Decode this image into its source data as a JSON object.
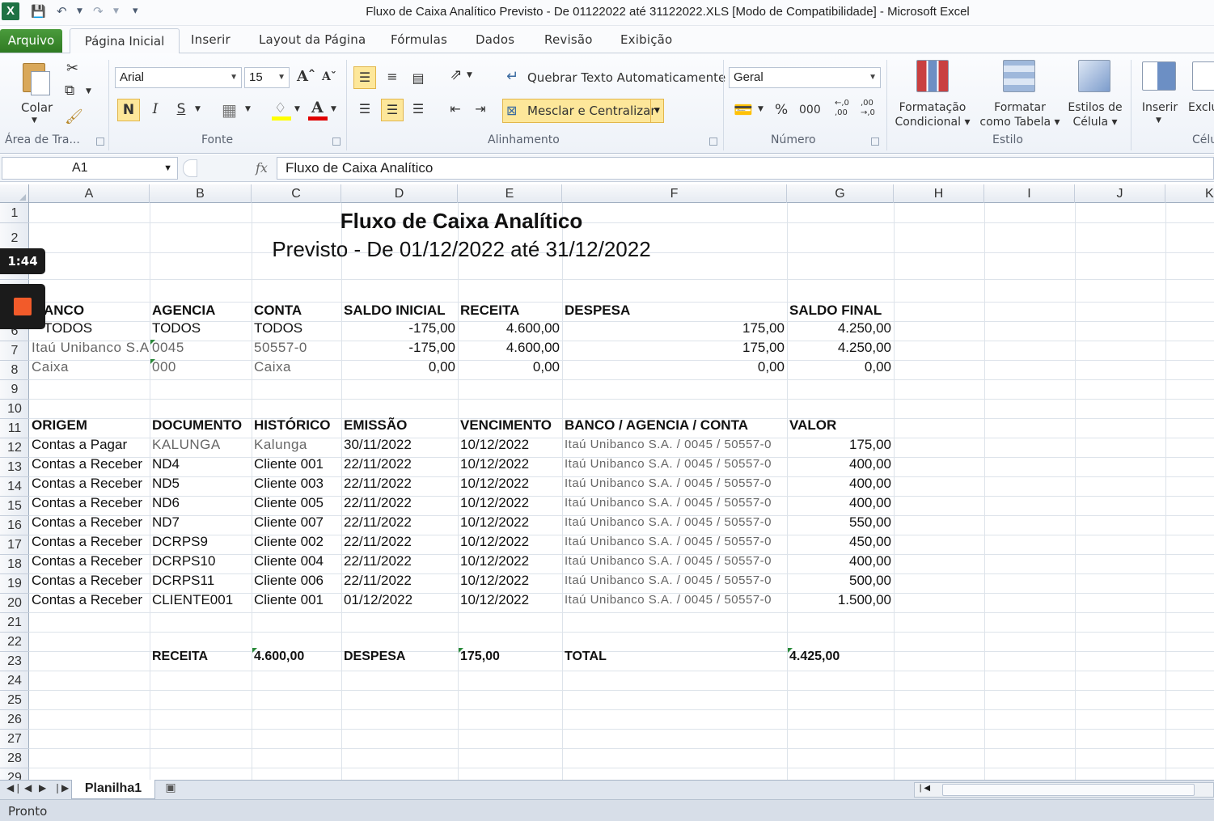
{
  "window": {
    "title": "Fluxo de Caixa Analítico Previsto - De 01122022 até 31122022.XLS  [Modo de Compatibilidade]  -  Microsoft Excel",
    "app_icon": "X"
  },
  "ribbon_tabs": [
    "Arquivo",
    "Página Inicial",
    "Inserir",
    "Layout da Página",
    "Fórmulas",
    "Dados",
    "Revisão",
    "Exibição"
  ],
  "ribbon": {
    "clipboard": {
      "paste_label": "Colar",
      "group_label": "Área de Tra..."
    },
    "font": {
      "font_name": "Arial",
      "font_size": "15",
      "bold": "N",
      "italic": "I",
      "underline": "S",
      "group_label": "Fonte"
    },
    "alignment": {
      "wrap_text": "Quebrar Texto Automaticamente",
      "merge_center": "Mesclar e Centralizar",
      "group_label": "Alinhamento"
    },
    "number": {
      "format": "Geral",
      "percent": "%",
      "thousands": "000",
      "inc_decimal": "←,0\n,00",
      "dec_decimal": ",00\n→,0",
      "group_label": "Número"
    },
    "styles": {
      "conditional": [
        "Formatação",
        "Condicional ▾"
      ],
      "as_table": [
        "Formatar",
        "como Tabela ▾"
      ],
      "cell_styles": [
        "Estilos de",
        "Célula ▾"
      ],
      "group_label": "Estilo"
    },
    "cells": {
      "insert": "Inserir",
      "delete": "Exclu",
      "group_label": "Célu"
    }
  },
  "formula_bar": {
    "name_box": "A1",
    "fx": "fx",
    "formula": "Fluxo de Caixa Analítico"
  },
  "columns": [
    "A",
    "B",
    "C",
    "D",
    "E",
    "F",
    "G",
    "H",
    "I",
    "J",
    "K"
  ],
  "rows": [
    "1",
    "2",
    "3",
    "4",
    "5",
    "6",
    "7",
    "8",
    "9",
    "10",
    "11",
    "12",
    "13",
    "14",
    "15",
    "16",
    "17",
    "18",
    "19",
    "20",
    "21",
    "22",
    "23",
    "24",
    "25",
    "26",
    "27",
    "28",
    "29"
  ],
  "sheet": {
    "title": "Fluxo de Caixa Analítico",
    "subtitle": "Previsto - De 01/12/2022 até 31/12/2022",
    "bank_headers": [
      "ANCO",
      "AGENCIA",
      "CONTA",
      "SALDO INICIAL",
      "RECEITA",
      "DESPESA",
      "SALDO FINAL"
    ],
    "bank_rows": [
      [
        "TODOS",
        "TODOS",
        "TODOS",
        "-175,00",
        "4.600,00",
        "175,00",
        "4.250,00"
      ],
      [
        "Itaú Unibanco S.A.",
        "0045",
        "50557-0",
        "-175,00",
        "4.600,00",
        "175,00",
        "4.250,00"
      ],
      [
        "Caixa",
        "000",
        "Caixa",
        "0,00",
        "0,00",
        "0,00",
        "0,00"
      ]
    ],
    "detail_headers": [
      "ORIGEM",
      "DOCUMENTO",
      "HISTÓRICO",
      "EMISSÃO",
      "VENCIMENTO",
      "BANCO / AGENCIA / CONTA",
      "VALOR"
    ],
    "detail_rows": [
      [
        "Contas a Pagar",
        "KALUNGA",
        "Kalunga",
        "30/11/2022",
        "10/12/2022",
        "Itaú Unibanco S.A. / 0045 / 50557-0",
        "175,00"
      ],
      [
        "Contas a Receber",
        "ND4",
        "Cliente 001",
        "22/11/2022",
        "10/12/2022",
        "Itaú Unibanco S.A. / 0045 / 50557-0",
        "400,00"
      ],
      [
        "Contas a Receber",
        "ND5",
        "Cliente 003",
        "22/11/2022",
        "10/12/2022",
        "Itaú Unibanco S.A. / 0045 / 50557-0",
        "400,00"
      ],
      [
        "Contas a Receber",
        "ND6",
        "Cliente 005",
        "22/11/2022",
        "10/12/2022",
        "Itaú Unibanco S.A. / 0045 / 50557-0",
        "400,00"
      ],
      [
        "Contas a Receber",
        "ND7",
        "Cliente 007",
        "22/11/2022",
        "10/12/2022",
        "Itaú Unibanco S.A. / 0045 / 50557-0",
        "550,00"
      ],
      [
        "Contas a Receber",
        "DCRPS9",
        "Cliente 002",
        "22/11/2022",
        "10/12/2022",
        "Itaú Unibanco S.A. / 0045 / 50557-0",
        "450,00"
      ],
      [
        "Contas a Receber",
        "DCRPS10",
        "Cliente 004",
        "22/11/2022",
        "10/12/2022",
        "Itaú Unibanco S.A. / 0045 / 50557-0",
        "400,00"
      ],
      [
        "Contas a Receber",
        "DCRPS11",
        "Cliente 006",
        "22/11/2022",
        "10/12/2022",
        "Itaú Unibanco S.A. / 0045 / 50557-0",
        "500,00"
      ],
      [
        "Contas a Receber",
        "CLIENTE001",
        "Cliente 001",
        "01/12/2022",
        "10/12/2022",
        "Itaú Unibanco S.A. / 0045 / 50557-0",
        "1.500,00"
      ]
    ],
    "totals": {
      "receita_label": "RECEITA",
      "receita": "4.600,00",
      "despesa_label": "DESPESA",
      "despesa": "175,00",
      "total_label": "TOTAL",
      "total": "4.425,00"
    }
  },
  "overlay": {
    "time": "1:44"
  },
  "sheet_tabs": [
    "Planilha1"
  ],
  "status": "Pronto",
  "colors": {
    "file_tab": "#2f7a22",
    "selected_button": "#fde79a",
    "stop": "#f25b2a"
  }
}
